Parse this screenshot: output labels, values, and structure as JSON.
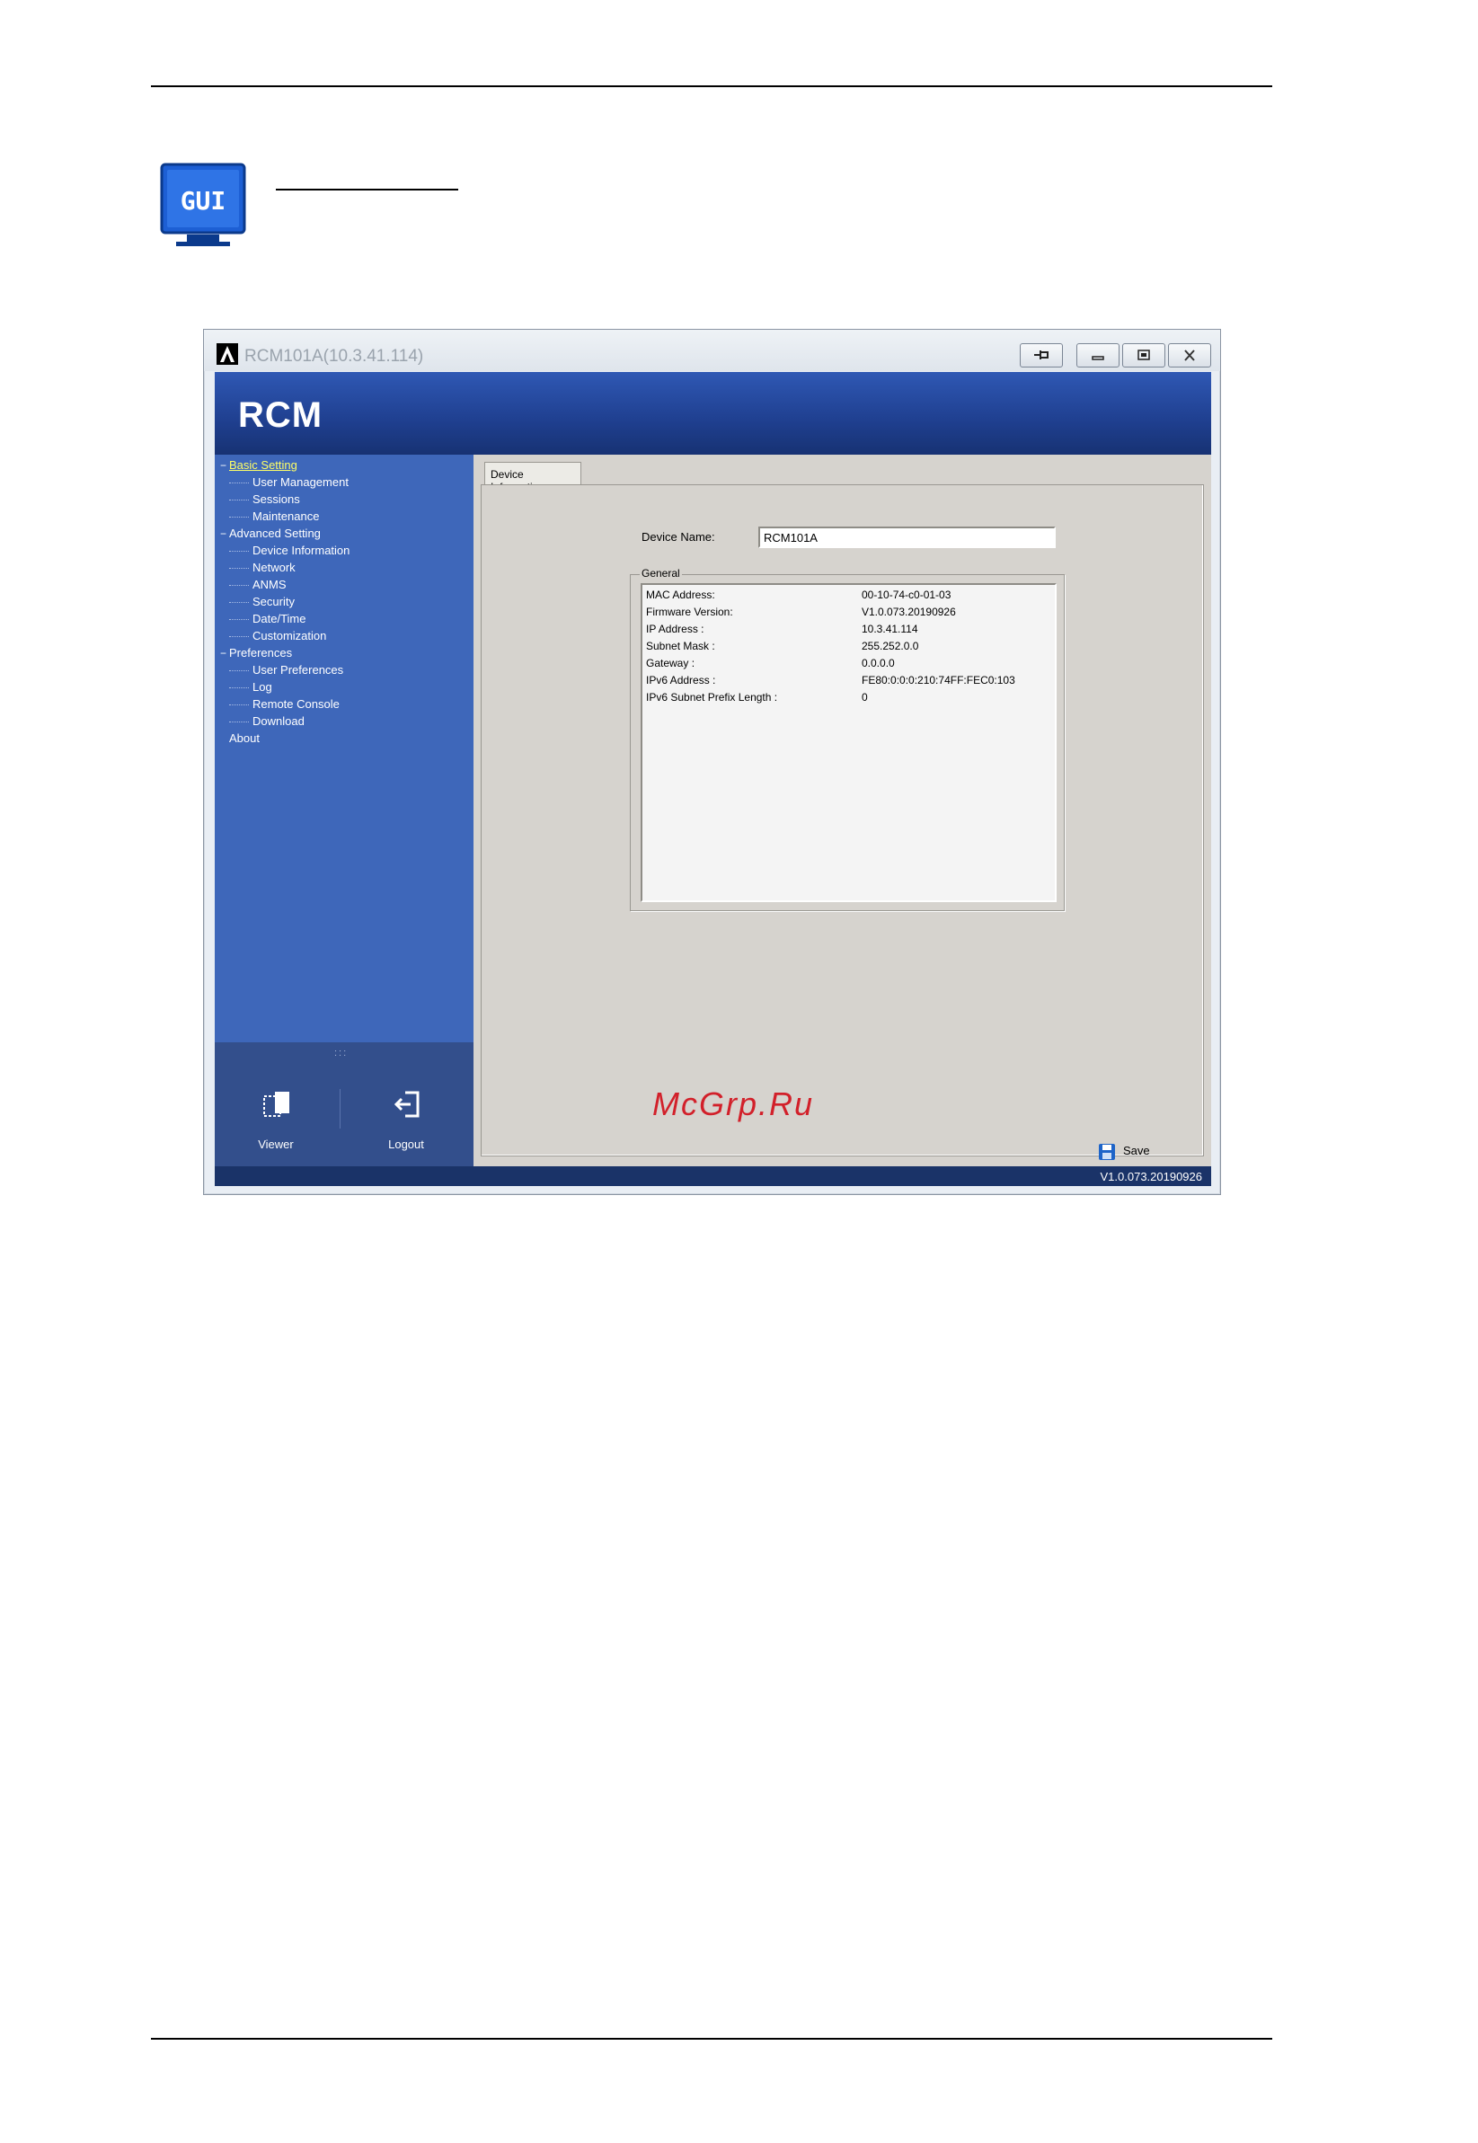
{
  "window": {
    "title": "RCM101A(10.3.41.114)"
  },
  "header": {
    "brand": "RCM"
  },
  "sidebar": {
    "nav": [
      {
        "label": "Basic Setting",
        "toggle": "−",
        "selected": true,
        "items": [
          "User Management",
          "Sessions",
          "Maintenance"
        ]
      },
      {
        "label": "Advanced Setting",
        "toggle": "−",
        "selected": false,
        "items": [
          "Device Information",
          "Network",
          "ANMS",
          "Security",
          "Date/Time",
          "Customization"
        ]
      },
      {
        "label": "Preferences",
        "toggle": "−",
        "selected": false,
        "items": [
          "User Preferences",
          "Log",
          "Remote Console",
          "Download"
        ]
      },
      {
        "label": "About",
        "toggle": "",
        "selected": false,
        "items": []
      }
    ],
    "footer": {
      "grip": ":::",
      "viewer_label": "Viewer",
      "logout_label": "Logout"
    }
  },
  "content": {
    "tab_label": "Device Information",
    "device_name_label": "Device Name:",
    "device_name_value": "RCM101A",
    "general_legend": "General",
    "info": [
      {
        "label": "MAC Address:",
        "value": "00-10-74-c0-01-03"
      },
      {
        "label": "Firmware Version:",
        "value": "V1.0.073.20190926"
      },
      {
        "label": "IP Address :",
        "value": "10.3.41.114"
      },
      {
        "label": "Subnet Mask :",
        "value": "255.252.0.0"
      },
      {
        "label": "Gateway :",
        "value": "0.0.0.0"
      },
      {
        "label": "IPv6 Address :",
        "value": "FE80:0:0:0:210:74FF:FEC0:103"
      },
      {
        "label": "IPv6 Subnet Prefix Length :",
        "value": "0"
      }
    ],
    "save_label": "Save",
    "watermark": "McGrp.Ru"
  },
  "status_bar": {
    "version": "V1.0.073.20190926"
  },
  "colors": {
    "sidebar": "#3e67ba",
    "header": "#1f3f8f",
    "selected_nav": "#ffff66",
    "watermark": "#d2202a"
  }
}
